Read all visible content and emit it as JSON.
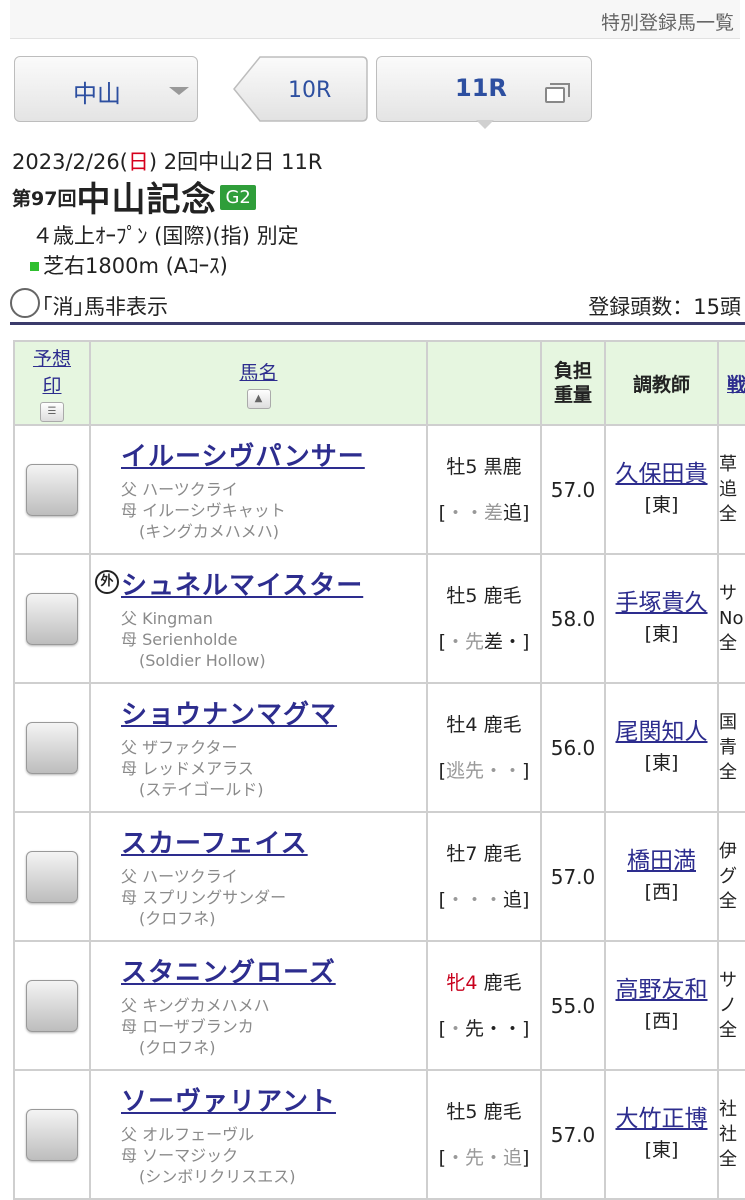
{
  "header": {
    "link": "特別登録馬一覧"
  },
  "nav": {
    "venue": "中山",
    "prev_race": "10R",
    "current_race": "11R"
  },
  "race": {
    "date_prefix": "2023/2/26(",
    "weekday": "日",
    "date_suffix": ") 2回中山2日 11R",
    "kai": "第97回",
    "name": "中山記念",
    "grade": "G2",
    "conditions": "４歳上ｵｰﾌﾟﾝ (国際)(指) 別定",
    "course": "芝右1800m (Aｺｰｽ)"
  },
  "filter": {
    "hide_label": "｢消｣馬非表示",
    "count": "登録頭数：15頭"
  },
  "table": {
    "headers": {
      "mark_line1": "予想",
      "mark_line2": "印",
      "name": "馬名",
      "weight_line1": "負担",
      "weight_line2": "重量",
      "trainer": "調教師",
      "next": "戦"
    },
    "rows": [
      {
        "name": "イルーシヴパンサー",
        "foreign": "",
        "sire": "父 ハーツクライ",
        "dam": "母 イルーシヴキャット",
        "damsire": "(キングカメハメハ)",
        "sex": "牡5",
        "sex_female": false,
        "coat": "黒鹿",
        "style_open": "[",
        "style_dim": "・・差",
        "style_bold": "追",
        "style_close": "]",
        "weight": "57.0",
        "trainer": "久保田貴",
        "region": "[東]",
        "owner1": "草",
        "owner2": "追",
        "owner3": "全"
      },
      {
        "name": "シュネルマイスター",
        "foreign": "外",
        "sire": "父 Kingman",
        "dam": "母 Serienholde",
        "damsire": "(Soldier Hollow)",
        "sex": "牡5",
        "sex_female": false,
        "coat": "鹿毛",
        "style_open": "[",
        "style_dim": "・先",
        "style_bold": "差",
        "style_close": "・]",
        "weight": "58.0",
        "trainer": "手塚貴久",
        "region": "[東]",
        "owner1": "サ",
        "owner2": "No",
        "owner3": "全"
      },
      {
        "name": "ショウナンマグマ",
        "foreign": "",
        "sire": "父 ザファクター",
        "dam": "母 レッドメアラス",
        "damsire": "(ステイゴールド)",
        "sex": "牡4",
        "sex_female": false,
        "coat": "鹿毛",
        "style_open": "[",
        "style_dim": "逃先・・",
        "style_bold": "",
        "style_close": "]",
        "weight": "56.0",
        "trainer": "尾関知人",
        "region": "[東]",
        "owner1": "国",
        "owner2": "青",
        "owner3": "全"
      },
      {
        "name": "スカーフェイス",
        "foreign": "",
        "sire": "父 ハーツクライ",
        "dam": "母 スプリングサンダー",
        "damsire": "(クロフネ)",
        "sex": "牡7",
        "sex_female": false,
        "coat": "鹿毛",
        "style_open": "[",
        "style_dim": "・・・",
        "style_bold": "追",
        "style_close": "]",
        "weight": "57.0",
        "trainer": "橋田満",
        "region": "[西]",
        "owner1": "伊",
        "owner2": "グ",
        "owner3": "全"
      },
      {
        "name": "スタニングローズ",
        "foreign": "",
        "sire": "父 キングカメハメハ",
        "dam": "母 ローザブランカ",
        "damsire": "(クロフネ)",
        "sex": "牝4",
        "sex_female": true,
        "coat": "鹿毛",
        "style_open": "[",
        "style_dim": "・",
        "style_bold": "先",
        "style_close": "・・]",
        "weight": "55.0",
        "trainer": "高野友和",
        "region": "[西]",
        "owner1": "サ",
        "owner2": "ノ",
        "owner3": "全"
      },
      {
        "name": "ソーヴァリアント",
        "foreign": "",
        "sire": "父 オルフェーヴル",
        "dam": "母 ソーマジック",
        "damsire": "(シンボリクリスエス)",
        "sex": "牡5",
        "sex_female": false,
        "coat": "鹿毛",
        "style_open": "[",
        "style_dim": "・先・追",
        "style_bold": "",
        "style_close": "]",
        "weight": "57.0",
        "trainer": "大竹正博",
        "region": "[東]",
        "owner1": "社",
        "owner2": "社",
        "owner3": "全"
      }
    ]
  }
}
